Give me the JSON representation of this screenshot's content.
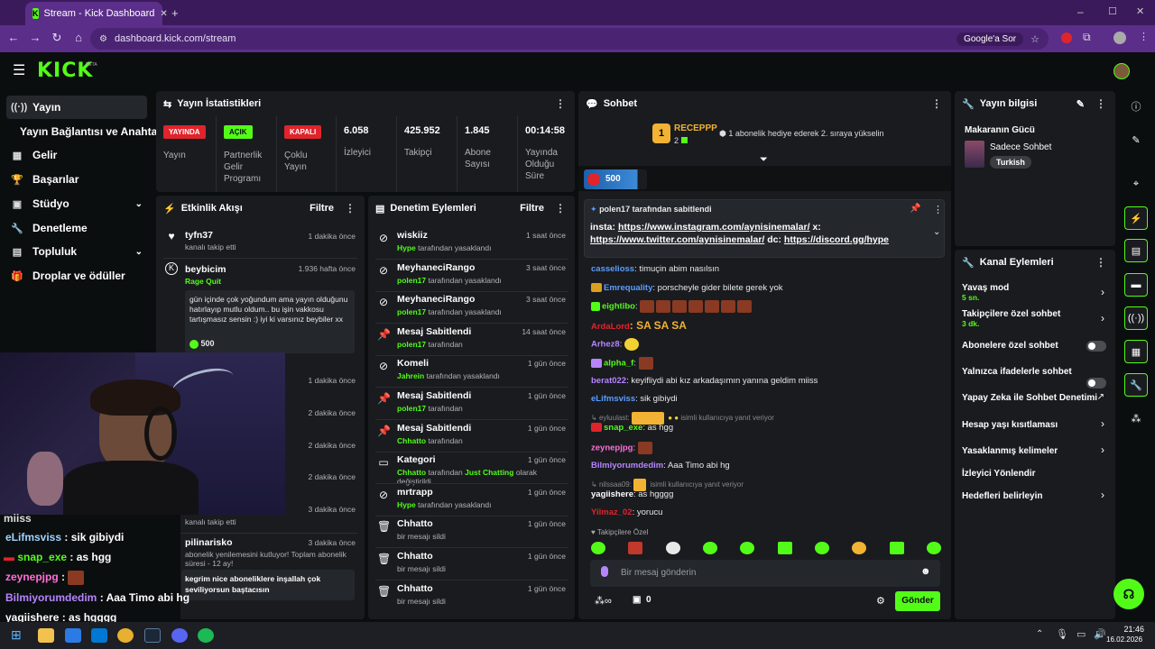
{
  "browser": {
    "tab_title": "Stream - Kick Dashboard",
    "url": "dashboard.kick.com/stream",
    "google_button": "Google'a Sor"
  },
  "kick": {
    "logo": "KICK",
    "beta": "BETA"
  },
  "nav": [
    {
      "label": "Yayın",
      "icon": "stream-icon"
    },
    {
      "label": "Yayın Bağlantısı ve Anahtarı",
      "icon": ""
    },
    {
      "label": "Gelir",
      "icon": "revenue-icon"
    },
    {
      "label": "Başarılar",
      "icon": "trophy-icon"
    },
    {
      "label": "Stüdyo",
      "icon": "studio-icon"
    },
    {
      "label": "Denetleme",
      "icon": "moderation-icon"
    },
    {
      "label": "Topluluk",
      "icon": "community-icon"
    },
    {
      "label": "Droplar ve ödüller",
      "icon": "drops-icon"
    }
  ],
  "stats": {
    "title": "Yayın İstatistikleri",
    "items": [
      {
        "badge": "YAYINDA",
        "label": "Yayın",
        "color": "#e0242c"
      },
      {
        "badge": "AÇIK",
        "label": "Partnerlik Gelir Programı",
        "color": "#53fc18"
      },
      {
        "badge": "KAPALI",
        "label": "Çoklu Yayın",
        "color": "#e0242c"
      },
      {
        "value": "6.058",
        "label": "İzleyici"
      },
      {
        "value": "425.952",
        "label": "Takipçi"
      },
      {
        "value": "1.845",
        "label": "Abone Sayısı"
      },
      {
        "value": "00:14:58",
        "label": "Yayında Olduğu Süre"
      }
    ]
  },
  "activity": {
    "title": "Etkinlik Akışı",
    "filter": "Filtre",
    "items": [
      {
        "name": "tyfn37",
        "sub": "kanalı takip etti",
        "time": "1 dakika önce"
      },
      {
        "name": "beybicim",
        "sub": "Rage Quit",
        "time": "1.936 hafta önce",
        "message": "gün içinde çok yoğundum ama yayın olduğunu hatırlayıp mutlu oldum.. bu işin vakkosu tartışmasız sensin :) iyi ki varsınız beybiler xx",
        "amount": "500"
      },
      {
        "time": "1 dakika önce"
      },
      {
        "time": "2 dakika önce"
      },
      {
        "time": "2 dakika önce"
      },
      {
        "time": "2 dakika önce"
      },
      {
        "time": "3 dakika önce",
        "sub": "kanalı takip etti"
      },
      {
        "name": "pilinarisko",
        "time": "3 dakika önce",
        "sub": "abonelik yenilemesini kutluyor! Toplam abonelik süresi - 12 ay!",
        "message": "kegrim nice aboneliklere inşallah çok seviliyorsun baştacısın"
      }
    ]
  },
  "moderation": {
    "title": "Denetim Eylemleri",
    "filter": "Filtre",
    "items": [
      {
        "title": "wiskiiz",
        "actor": "Hype",
        "suffix": "tarafından yasaklandı",
        "time": "1 saat önce",
        "icon": "ban-icon"
      },
      {
        "title": "MeyhaneciRango",
        "actor": "polen17",
        "suffix": "tarafından yasaklandı",
        "time": "3 saat önce",
        "icon": "ban-icon"
      },
      {
        "title": "MeyhaneciRango",
        "actor": "polen17",
        "suffix": "tarafından yasaklandı",
        "time": "3 saat önce",
        "icon": "ban-icon"
      },
      {
        "title": "Mesaj Sabitlendi",
        "actor": "polen17",
        "suffix": "tarafından",
        "time": "14 saat önce",
        "icon": "pin-icon"
      },
      {
        "title": "Komeli",
        "actor": "Jahrein",
        "suffix": "tarafından yasaklandı",
        "time": "1 gün önce",
        "icon": "ban-icon"
      },
      {
        "title": "Mesaj Sabitlendi",
        "actor": "polen17",
        "suffix": "tarafından",
        "time": "1 gün önce",
        "icon": "pin-icon"
      },
      {
        "title": "Mesaj Sabitlendi",
        "actor": "Chhatto",
        "suffix": "tarafından",
        "time": "1 gün önce",
        "icon": "pin-icon"
      },
      {
        "title": "Kategori",
        "actor": "Chhatto",
        "suffix": "tarafından",
        "extra": "Just Chatting",
        "extra_suffix": "olarak değiştirildi",
        "time": "1 gün önce",
        "icon": "category-icon"
      },
      {
        "title": "mrtrapp",
        "actor": "Hype",
        "suffix": "tarafından yasaklandı",
        "time": "1 gün önce",
        "icon": "ban-icon"
      },
      {
        "title": "Chhatto",
        "actor": "",
        "suffix": "bir mesajı sildi",
        "time": "1 gün önce",
        "icon": "trash-icon"
      },
      {
        "title": "Chhatto",
        "actor": "",
        "suffix": "bir mesajı sildi",
        "time": "1 gün önce",
        "icon": "trash-icon"
      },
      {
        "title": "Chhatto",
        "actor": "",
        "suffix": "bir mesajı sildi",
        "time": "1 gün önce",
        "icon": "trash-icon"
      }
    ]
  },
  "chat": {
    "title": "Sohbet",
    "top_user": "RECEPPP",
    "top_rank": "1",
    "top_count": "2",
    "gift_note": "1 abonelik hediye ederek 2. sıraya yükselin",
    "bar_value": "500",
    "pinned_by": "polen17 tarafından sabitlendi",
    "pinned_text_1": "insta:",
    "pinned_link_1": "https://www.instagram.com/aynisinemalar/",
    "pinned_text_2": "x:",
    "pinned_link_2": "https://www.twitter.com/aynisinemalar/",
    "pinned_text_3": "dc:",
    "pinned_link_3": "https://discord.gg/hype",
    "messages": [
      {
        "user": "casselioss",
        "text": ": timuçin abim nasılsın",
        "color": "#5b9cff"
      },
      {
        "user": "Emrequality",
        "text": ": porscheyle gider bilete gerek yok",
        "color": "#5b9cff"
      },
      {
        "user": "eightibo",
        "text": ":",
        "color": "#53fc18"
      },
      {
        "user": "ArdaLord",
        "text": ": SA SA SA",
        "color": "#e0242c"
      },
      {
        "user": "Arhez8",
        "text": ":",
        "color": "#b585ff"
      },
      {
        "user": "alpha_f",
        "text": ":",
        "color": "#53fc18"
      },
      {
        "user": "berat022",
        "text": ": keyifliydi abi kız arkadaşımın yanına geldim miiss",
        "color": "#b585ff"
      },
      {
        "user": "eLifmsviss",
        "text": ": sik gibiydi",
        "color": "#5b9cff"
      },
      {
        "user": "snap_exe",
        "text": ": as hgg",
        "color": "#53fc18"
      },
      {
        "user": "zeynepjpg",
        "text": ":",
        "color": "#ff6fd8"
      },
      {
        "user": "Bilmiyorumdedim",
        "text": ": Aaa Timo abi hg",
        "color": "#b585ff"
      },
      {
        "user": "yagiishere",
        "text": ": as hgggg",
        "color": "#ffffff"
      },
      {
        "user": "Yilmaz_02",
        "text": ": yorucu",
        "color": "#e0242c"
      }
    ],
    "reply_1": "eyluulast:",
    "reply_1_note": "isimli kullanıcıya yanıt veriyor",
    "reply_2": "nilssaa09:",
    "reply_2_note": "isimli kullanıcıya yanıt veriyor",
    "followers_only": "Takipçilere Özel",
    "input_placeholder": "Bir mesaj gönderin",
    "send": "Gönder",
    "bottom_count": "0"
  },
  "stream_info": {
    "title": "Yayın bilgisi",
    "stream_title": "Makaranın Gücü",
    "category": "Sadece Sohbet",
    "tag": "Turkish"
  },
  "channel_actions": {
    "title": "Kanal Eylemleri",
    "items": [
      {
        "label": "Yavaş mod",
        "sub": "5 sn.",
        "control": "chevron"
      },
      {
        "label": "Takipçilere özel sohbet",
        "sub": "3 dk.",
        "control": "chevron"
      },
      {
        "label": "Abonelere özel sohbet",
        "control": "toggle"
      },
      {
        "label": "Yalnızca ifadelerle sohbet",
        "control": "toggle"
      },
      {
        "label": "Yapay Zeka ile Sohbet Denetimi",
        "control": "external"
      },
      {
        "label": "Hesap yaşı kısıtlaması",
        "control": "chevron"
      },
      {
        "label": "Yasaklanmış kelimeler",
        "control": "chevron"
      },
      {
        "label": "İzleyici Yönlendir",
        "control": "none"
      },
      {
        "label": "Hedefleri belirleyin",
        "control": "chevron"
      }
    ]
  },
  "overlay_chat": [
    {
      "user": "miiss",
      "text": ""
    },
    {
      "user": "eLifmsviss",
      "text": " : sik gibiydi"
    },
    {
      "user": "snap_exe",
      "text": " : as hgg"
    },
    {
      "user": "zeynepjpg",
      "text": " :"
    },
    {
      "user": "Bilmiyorumdedim",
      "text": " : Aaa Timo abi hg"
    },
    {
      "user": "yagiishere",
      "text": " : as hgggg"
    }
  ],
  "taskbar": {
    "time": "21:46",
    "date": "16.02.2026"
  }
}
